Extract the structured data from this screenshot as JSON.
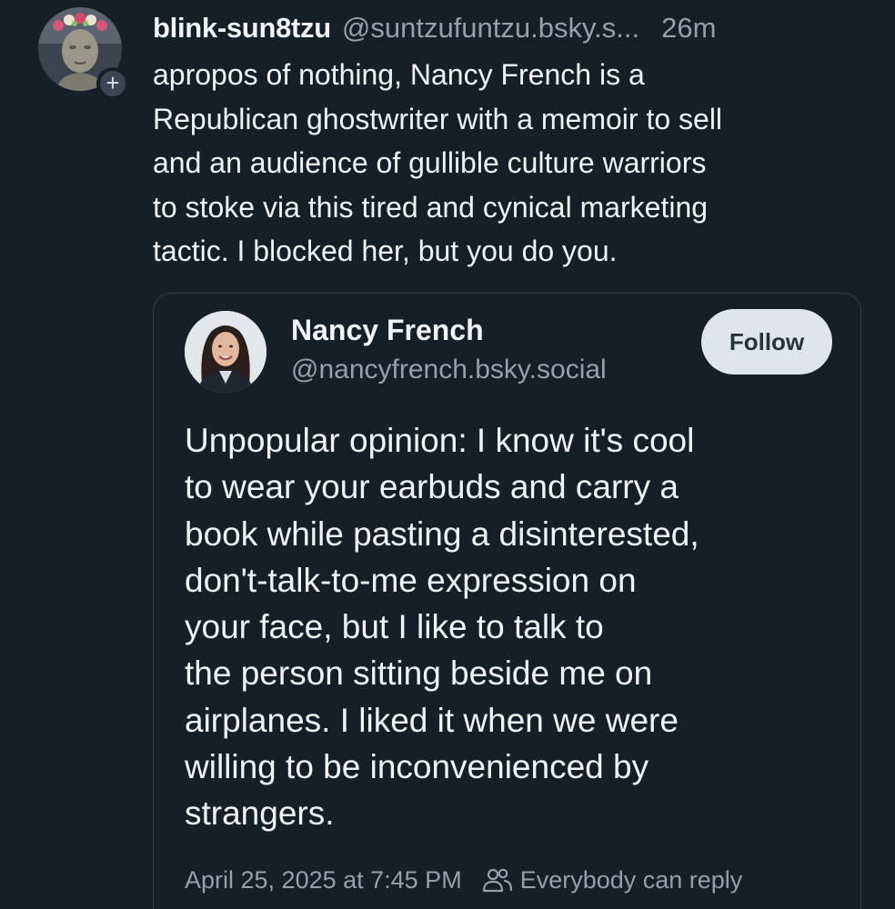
{
  "post": {
    "author_name": "blink-sun8tzu",
    "author_handle": "@suntzufuntzu.bsky.s...",
    "time": "26m",
    "follow_plus": "+",
    "text_lines": [
      "apropos of nothing, Nancy French is a",
      "Republican ghostwriter with a memoir to sell",
      "and an audience of gullible culture warriors",
      "to stoke via this tired and cynical marketing",
      "tactic. I blocked her, but you do you."
    ]
  },
  "quote": {
    "author_name": "Nancy French",
    "author_handle": "@nancyfrench.bsky.social",
    "follow_label": "Follow",
    "text_lines": [
      "Unpopular opinion: I know it's cool",
      "to wear your earbuds and carry a",
      "book while pasting a disinterested,",
      "don't-talk-to-me expression on",
      "your face, but I like to talk to",
      "the person sitting beside me on",
      "airplanes. I liked it when we were",
      "willing to be inconvenienced by",
      "strangers."
    ],
    "timestamp": "April 25, 2025 at 7:45 PM",
    "reply_setting": "Everybody can reply"
  },
  "icons": {
    "follow_plus": "plus-icon",
    "reply_setting": "people-icon"
  },
  "colors": {
    "background": "#161e27",
    "text_primary": "#f1f3f5",
    "text_secondary": "#93a0ad",
    "border": "#2e3946",
    "follow_button_bg": "#dfe5ea"
  }
}
